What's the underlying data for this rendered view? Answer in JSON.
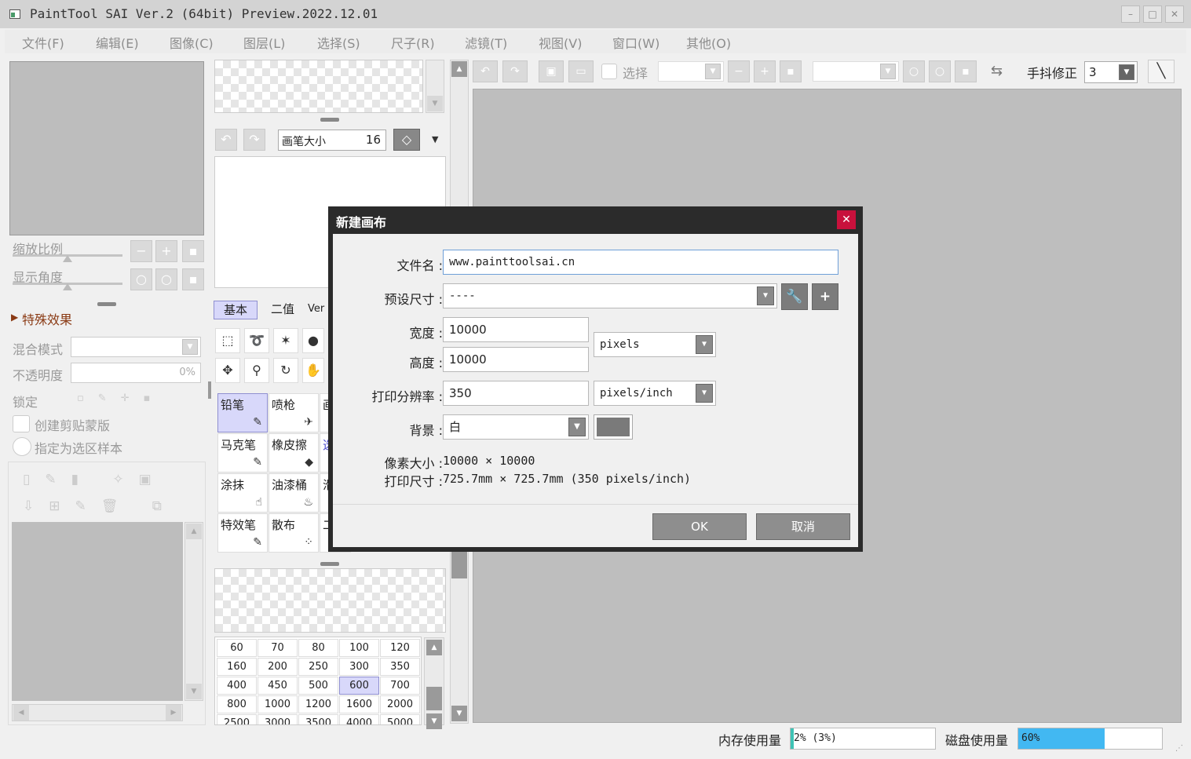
{
  "window": {
    "title": "PaintTool SAI Ver.2 (64bit) Preview.2022.12.01",
    "minimize": "–",
    "maximize": "□",
    "close": "✕"
  },
  "menu": [
    "文件(F)",
    "编辑(E)",
    "图像(C)",
    "图层(L)",
    "选择(S)",
    "尺子(R)",
    "滤镜(T)",
    "视图(V)",
    "窗口(W)",
    "其他(O)"
  ],
  "navigator": {
    "zoom_label": "缩放比例",
    "rotate_label": "显示角度"
  },
  "layer_props": {
    "effects_label": "特殊效果",
    "blend_label": "混合模式",
    "opacity_label": "不透明度",
    "opacity_value": "0%",
    "lock_label": "锁定",
    "clip_label": "创建剪贴蒙版",
    "selection_source_label": "指定为选区样本"
  },
  "brush": {
    "size_label": "画笔大小",
    "size_value": "16"
  },
  "tool_tabs": [
    "基本",
    "二值",
    "Ver"
  ],
  "tools": [
    {
      "name": "铅笔",
      "icon": "✎"
    },
    {
      "name": "喷枪",
      "icon": "✈"
    },
    {
      "name": "马克笔",
      "icon": "✎"
    },
    {
      "name": "橡皮擦",
      "icon": "◆"
    },
    {
      "name": "涂抹",
      "icon": "☝"
    },
    {
      "name": "油漆桶",
      "icon": "♨"
    },
    {
      "name": "特效笔",
      "icon": "✎"
    },
    {
      "name": "散布",
      "icon": "⁘"
    }
  ],
  "tool_partial_labels": [
    "画",
    "选",
    "滑",
    "二"
  ],
  "brush_sizes": [
    [
      "60",
      "70",
      "80",
      "100",
      "120"
    ],
    [
      "160",
      "200",
      "250",
      "300",
      "350"
    ],
    [
      "400",
      "450",
      "500",
      "600",
      "700"
    ],
    [
      "800",
      "1000",
      "1200",
      "1600",
      "2000"
    ],
    [
      "2500",
      "3000",
      "3500",
      "4000",
      "5000"
    ]
  ],
  "selected_brush_size": "600",
  "toolbar": {
    "select_label": "选择",
    "stabilizer_label": "手抖修正",
    "stabilizer_value": "3"
  },
  "status": {
    "memory_label": "内存使用量",
    "memory_value": "2% (3%)",
    "memory_fraction": 0.02,
    "disk_label": "磁盘使用量",
    "disk_value": "60%",
    "disk_fraction": 0.6,
    "memory_color": "#3fc3b5",
    "disk_color": "#42b8f2"
  },
  "dialog": {
    "title": "新建画布",
    "filename_label": "文件名 :",
    "filename_value": "www.painttoolsai.cn",
    "preset_label": "预设尺寸 :",
    "preset_value": "----",
    "width_label": "宽度 :",
    "width_value": "10000",
    "height_label": "高度 :",
    "height_value": "10000",
    "size_unit": "pixels",
    "dpi_label": "打印分辨率 :",
    "dpi_value": "350",
    "dpi_unit": "pixels/inch",
    "bg_label": "背景 :",
    "bg_value": "白",
    "pixel_size_label": "像素大小 :",
    "pixel_size_value": "10000  ×  10000",
    "print_size_label": "打印尺寸 :",
    "print_size_value": "725.7mm  ×  725.7mm (350 pixels/inch)",
    "ok_label": "OK",
    "cancel_label": "取消"
  }
}
